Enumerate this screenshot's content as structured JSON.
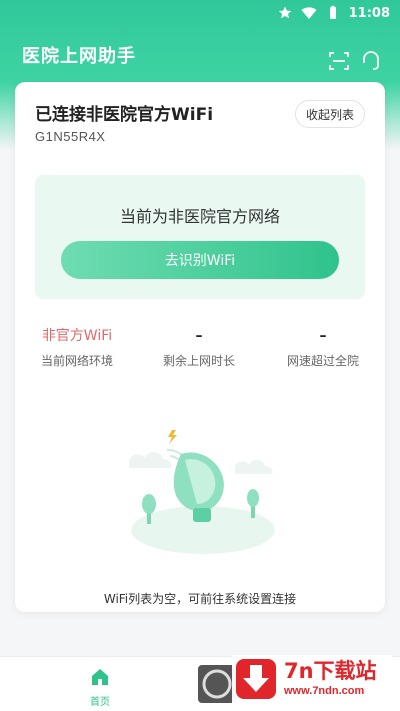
{
  "status_bar": {
    "time": "11:08",
    "icons": [
      "star-icon",
      "wifi-signal-icon",
      "battery-icon"
    ]
  },
  "app_bar": {
    "title": "医院上网助手",
    "icons": [
      "scan-icon",
      "customer-service-icon"
    ]
  },
  "wifi_card": {
    "ssid": "已连接非医院官方WiFi",
    "bssid": "G1N55R4X",
    "collapse_label": "收起列表",
    "notice": "当前为非医院官方网络",
    "identify_button": "去识别WiFi",
    "stats": [
      {
        "value": "非官方WiFi",
        "label": "当前网络环境"
      },
      {
        "value": "–",
        "label": "剩余上网时长"
      },
      {
        "value": "–",
        "label": "网速超过全院"
      }
    ],
    "empty_text": "WiFi列表为空，可前往系统设置连接"
  },
  "bottom_nav": {
    "items": [
      {
        "label": "首页",
        "icon": "home-icon",
        "active": true
      },
      {
        "label": "",
        "icon": "nav-circle-icon"
      }
    ]
  },
  "watermark": {
    "title": "7n下载站",
    "url": "www.7ndn.com"
  },
  "colors": {
    "brand": "#30c89a",
    "accent_red": "#e06a6a",
    "watermark_red": "#e0262b"
  }
}
